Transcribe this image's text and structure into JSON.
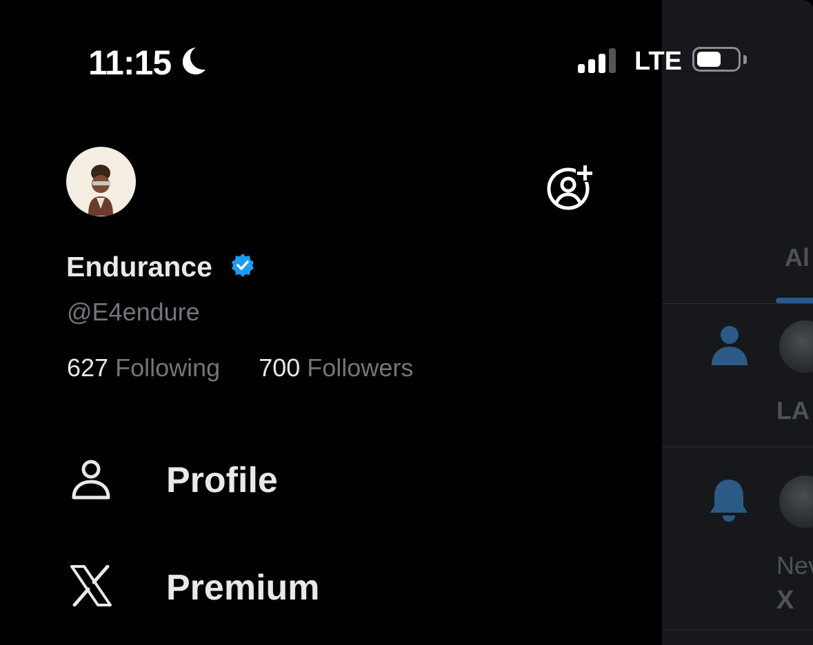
{
  "status_bar": {
    "time": "11:15",
    "network": "LTE",
    "focus_icon": "moon-icon",
    "signal_bars_filled": 3,
    "signal_bars_total": 4
  },
  "profile": {
    "display_name": "Endurance",
    "handle": "@E4endure",
    "verified": true,
    "following_count": "627",
    "following_label": "Following",
    "followers_count": "700",
    "followers_label": "Followers"
  },
  "menu": {
    "items": [
      {
        "label": "Profile",
        "icon": "person-icon"
      },
      {
        "label": "Premium",
        "icon": "x-logo-icon"
      }
    ]
  },
  "background_panel": {
    "tab_label": "Al",
    "notification_name": "LA",
    "notification_text": "Nev",
    "notification_source": "X"
  },
  "colors": {
    "background": "#000000",
    "text_primary": "#e7e9ea",
    "text_secondary": "#71767b",
    "verified_blue": "#1d9bf0",
    "panel_background": "#16181c"
  }
}
